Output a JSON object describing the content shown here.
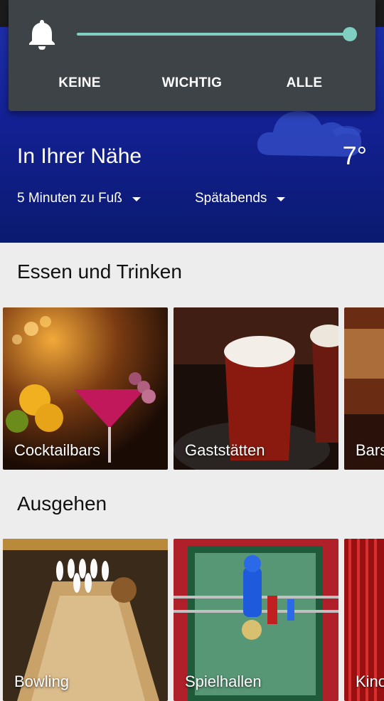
{
  "notification_panel": {
    "levels": [
      "KEINE",
      "WICHTIG",
      "ALLE"
    ],
    "selected_level": "ALLE",
    "slider_fraction": 1.0,
    "icon": "bell-icon",
    "accent_color": "#7fd0c2"
  },
  "header": {
    "title": "In Ihrer Nähe",
    "temperature": "7°",
    "weather_icon": "cloud-icon",
    "filters": {
      "distance": "5 Minuten zu Fuß",
      "time": "Spätabends"
    }
  },
  "sections": [
    {
      "title": "Essen und Trinken",
      "cards": [
        {
          "label": "Cocktailbars",
          "image": "cocktail-image"
        },
        {
          "label": "Gaststätten",
          "image": "beer-image"
        },
        {
          "label": "Bars",
          "image": "bar-image"
        }
      ]
    },
    {
      "title": "Ausgehen",
      "cards": [
        {
          "label": "Bowling",
          "image": "bowling-image"
        },
        {
          "label": "Spielhallen",
          "image": "foosball-image"
        },
        {
          "label": "Kino",
          "image": "cinema-image"
        }
      ]
    }
  ]
}
